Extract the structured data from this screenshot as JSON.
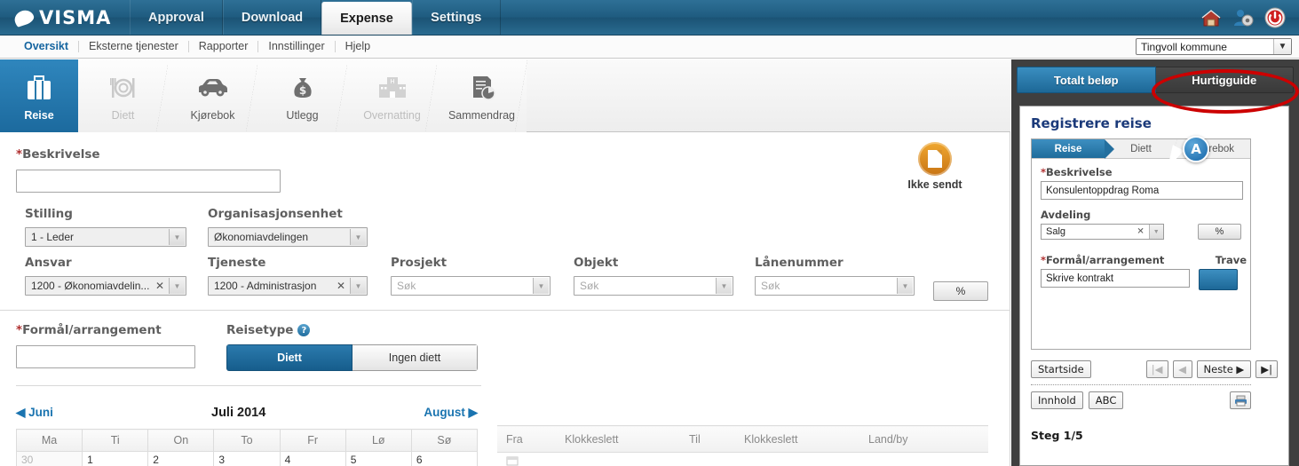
{
  "header": {
    "logo_text": "VISMA",
    "nav_tabs": [
      {
        "label": "Approval",
        "active": false
      },
      {
        "label": "Download",
        "active": false
      },
      {
        "label": "Expense",
        "active": true
      },
      {
        "label": "Settings",
        "active": false
      }
    ],
    "icons": [
      "home-icon",
      "user-settings-icon",
      "power-icon"
    ]
  },
  "subnav": {
    "items": [
      {
        "label": "Oversikt",
        "active": true
      },
      {
        "label": "Eksterne tjenester",
        "active": false
      },
      {
        "label": "Rapporter",
        "active": false
      },
      {
        "label": "Innstillinger",
        "active": false
      },
      {
        "label": "Hjelp",
        "active": false
      }
    ],
    "company": "Tingvoll kommune"
  },
  "steps": [
    {
      "label": "Reise",
      "icon": "suitcase-icon",
      "state": "active"
    },
    {
      "label": "Diett",
      "icon": "cutlery-plate-icon",
      "state": "disabled"
    },
    {
      "label": "Kjørebok",
      "icon": "car-icon",
      "state": "enabled"
    },
    {
      "label": "Utlegg",
      "icon": "money-bag-icon",
      "state": "enabled"
    },
    {
      "label": "Overnatting",
      "icon": "hotel-icon",
      "state": "disabled"
    },
    {
      "label": "Sammendrag",
      "icon": "report-chart-icon",
      "state": "enabled"
    }
  ],
  "form": {
    "beskrivelse": {
      "label": "Beskrivelse",
      "required": true,
      "value": ""
    },
    "status": {
      "label": "Ikke sendt",
      "icon": "document-badge-icon"
    },
    "fields_row1": [
      {
        "name": "stilling",
        "label": "Stilling",
        "value": "1 - Leder",
        "clearable": false,
        "type": "select"
      },
      {
        "name": "organisasjonsenhet",
        "label": "Organisasjonsenhet",
        "value": "Økonomiavdelingen",
        "clearable": false,
        "type": "select"
      }
    ],
    "fields_row2": [
      {
        "name": "ansvar",
        "label": "Ansvar",
        "value": "1200 - Økonomiavdelin...",
        "clearable": true,
        "type": "select"
      },
      {
        "name": "tjeneste",
        "label": "Tjeneste",
        "value": "1200 - Administrasjon",
        "clearable": true,
        "type": "select"
      },
      {
        "name": "prosjekt",
        "label": "Prosjekt",
        "value": "",
        "placeholder": "Søk",
        "clearable": false,
        "type": "search"
      },
      {
        "name": "objekt",
        "label": "Objekt",
        "value": "",
        "placeholder": "Søk",
        "clearable": false,
        "type": "search"
      },
      {
        "name": "lanenummer",
        "label": "Lånenummer",
        "value": "",
        "placeholder": "Søk",
        "clearable": false,
        "type": "search"
      }
    ],
    "percent_button": "%",
    "formal": {
      "label": "Formål/arrangement",
      "required": true,
      "value": ""
    },
    "reisetype": {
      "label": "Reisetype",
      "help_icon": "help-icon",
      "options": [
        {
          "label": "Diett",
          "selected": true
        },
        {
          "label": "Ingen diett",
          "selected": false
        }
      ]
    }
  },
  "calendar": {
    "prev_month": "Juni",
    "title": "Juli 2014",
    "next_month": "August",
    "weekdays": [
      "Ma",
      "Ti",
      "On",
      "To",
      "Fr",
      "Lø",
      "Sø"
    ],
    "week_rows": [
      [
        {
          "day": "30",
          "other": true
        },
        {
          "day": "1",
          "other": false
        },
        {
          "day": "2",
          "other": false
        },
        {
          "day": "3",
          "other": false
        },
        {
          "day": "4",
          "other": false
        },
        {
          "day": "5",
          "other": false
        },
        {
          "day": "6",
          "other": false
        }
      ]
    ]
  },
  "trip_table": {
    "columns": [
      "Fra",
      "Klokkeslett",
      "Til",
      "Klokkeslett",
      "Land/by"
    ],
    "rows": []
  },
  "sidebar": {
    "tabs": [
      {
        "label": "Totalt beløp",
        "style": "blue"
      },
      {
        "label": "Hurtigguide",
        "style": "dark",
        "highlighted": true
      }
    ],
    "panel_title": "Registrere reise",
    "mini_tabs": [
      {
        "label": "Reise",
        "active": true
      },
      {
        "label": "Diett",
        "active": false
      },
      {
        "label": "Kjørebok",
        "active": false
      }
    ],
    "mini_form": {
      "beskrivelse": {
        "label": "Beskrivelse",
        "required": true,
        "value": "Konsulentoppdrag Roma"
      },
      "avdeling": {
        "label": "Avdeling",
        "value": "Salg",
        "percent_button": "%"
      },
      "formal": {
        "label": "Formål/arrangement",
        "required": true,
        "value": "Skrive kontrakt"
      },
      "travel_label": "Trave",
      "callout_marker": "A"
    },
    "nav": {
      "startside": "Startside",
      "first": "|◀",
      "prev": "◀",
      "next": "Neste ▶",
      "last": "▶|",
      "innhold": "Innhold",
      "abc": "ABC",
      "print_icon": "print-icon"
    },
    "step_counter": "Steg 1/5"
  },
  "colors": {
    "header_blue": "#1f5c80",
    "accent_blue": "#1d6897",
    "active_step": "#236f9f",
    "link_blue": "#1a74b0",
    "required_red": "#b03030",
    "highlight_red": "#cc0000",
    "badge_orange": "#d8912c",
    "sidebar_dark": "#3f3f3f",
    "panel_title_navy": "#1b3a7a"
  }
}
